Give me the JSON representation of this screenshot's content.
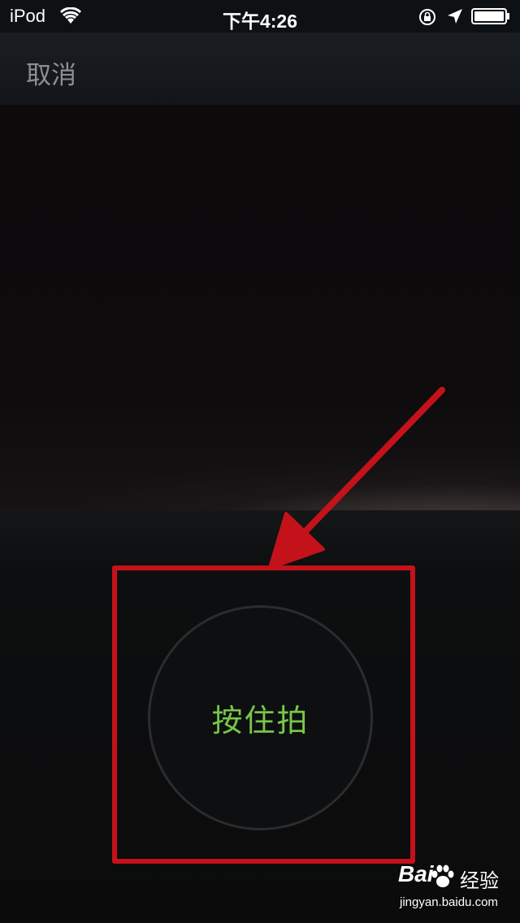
{
  "status_bar": {
    "carrier": "iPod",
    "time": "下午4:26",
    "icons": [
      "wifi-icon",
      "rotation-lock-icon",
      "location-icon",
      "battery-icon"
    ]
  },
  "nav": {
    "cancel_label": "取消"
  },
  "shutter": {
    "label": "按住拍"
  },
  "annotation": {
    "arrow_color": "#c4121a",
    "box_color": "#c4121a"
  },
  "watermark": {
    "logo_text_left": "Bai",
    "logo_text_right": "经验",
    "url": "jingyan.baidu.com"
  },
  "colors": {
    "accent_green": "#78c64a",
    "cancel_gray": "#8c8f93"
  }
}
